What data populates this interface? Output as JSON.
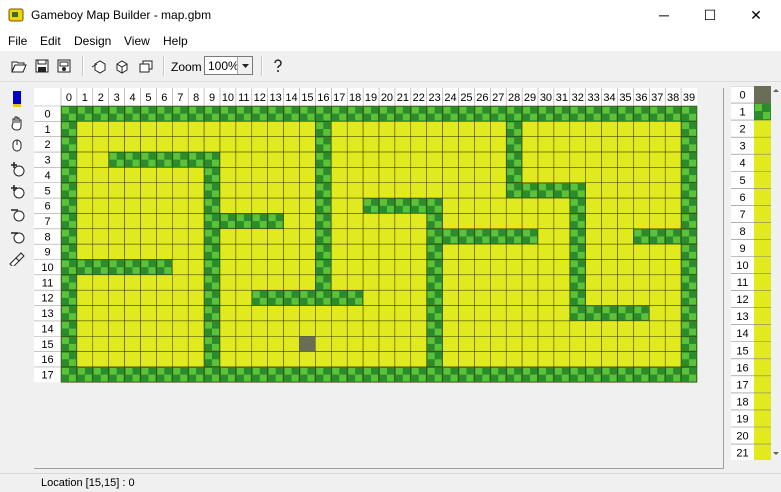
{
  "window": {
    "title": "Gameboy Map Builder - map.gbm",
    "minimize_glyph": "─",
    "maximize_glyph": "☐",
    "close_glyph": "✕"
  },
  "menu": [
    "File",
    "Edit",
    "Design",
    "View",
    "Help"
  ],
  "toolbar": {
    "icons": [
      "open-icon",
      "save-icon",
      "save-as-icon",
      "copy-icon",
      "cut-icon",
      "paste-icon",
      "help-icon"
    ],
    "zoom_label": "Zoom",
    "zoom_value": "100%"
  },
  "tools": [
    "pointer-tool",
    "hand-tool",
    "zoom-tool",
    "add-row-tool",
    "add-column-tool",
    "delete-row-tool",
    "delete-column-tool",
    "fill-tool"
  ],
  "map": {
    "width": 40,
    "height": 18,
    "col_labels": [
      "0",
      "1",
      "2",
      "3",
      "4",
      "5",
      "6",
      "7",
      "8",
      "9",
      "10",
      "11",
      "12",
      "13",
      "14",
      "15",
      "16",
      "17",
      "18",
      "19",
      "20",
      "21",
      "22",
      "23",
      "24",
      "25",
      "26",
      "27",
      "28",
      "29",
      "30",
      "31",
      "32",
      "33",
      "34",
      "35",
      "36",
      "37",
      "38",
      "39"
    ],
    "row_labels": [
      "0",
      "1",
      "2",
      "3",
      "4",
      "5",
      "6",
      "7",
      "8",
      "9",
      "10",
      "11",
      "12",
      "13",
      "14",
      "15",
      "16",
      "17"
    ],
    "rows": [
      "1111111111111111111111111111111111111111",
      "1000000000000000100000000000000000000001",
      "1000000000000000100000000000000000000001",
      "1000000000000000100000000000000000000001",
      "1000000000000000000000000000000000000001",
      "1000000000000000000000000000000000000001",
      "1000000000000000000000000000000000000001",
      "1000000000000000000000000000000000000001",
      "1000000000000000000000000000000000000001",
      "1000000000000000000000000000000000000001",
      "1000000000000000000000000000000000000001",
      "1000000000000000000000000000000000000001",
      "1000000000000000000000000000000000000001",
      "1000000000000000000000000000000000000001",
      "1000000000000000000000000000000000000001",
      "1000000000000000000000000000000000000001",
      "1000000000000000000000000000000000000001",
      "1111111111111111111111111111111111111111"
    ],
    "walls": [
      {
        "row": 3,
        "from": 3,
        "to": 9
      },
      {
        "row": 10,
        "from": 1,
        "to": 6
      },
      {
        "row": 7,
        "from": 10,
        "to": 13
      },
      {
        "row": 12,
        "from": 12,
        "to": 18
      },
      {
        "row": 6,
        "from": 19,
        "to": 23
      },
      {
        "row": 8,
        "from": 24,
        "to": 29
      },
      {
        "row": 5,
        "from": 28,
        "to": 32
      },
      {
        "row": 8,
        "from": 36,
        "to": 38
      },
      {
        "row": 13,
        "from": 32,
        "to": 36
      }
    ],
    "vwalls": [
      {
        "col": 9,
        "from": 3,
        "to": 16
      },
      {
        "col": 16,
        "from": 1,
        "to": 12
      },
      {
        "col": 23,
        "from": 6,
        "to": 16
      },
      {
        "col": 28,
        "from": 1,
        "to": 5
      },
      {
        "col": 32,
        "from": 5,
        "to": 13
      }
    ],
    "cursor": {
      "col": 15,
      "row": 15
    }
  },
  "tile_panel": {
    "labels": [
      "0",
      "1",
      "2",
      "3",
      "4",
      "5",
      "6",
      "7",
      "8",
      "9",
      "10",
      "11",
      "12",
      "13",
      "14",
      "15",
      "16",
      "17",
      "18",
      "19",
      "20",
      "21"
    ]
  },
  "colors": {
    "floor": "#e0ea1e",
    "wall_dark": "#2c8b2c",
    "wall_light": "#5cc23a",
    "grid": "#3a3a00",
    "cursor": "#6b6e57",
    "header_bg": "#ffffff",
    "header_line": "#a0a0a0"
  },
  "status": {
    "text": "Location    [15,15] : 0"
  }
}
